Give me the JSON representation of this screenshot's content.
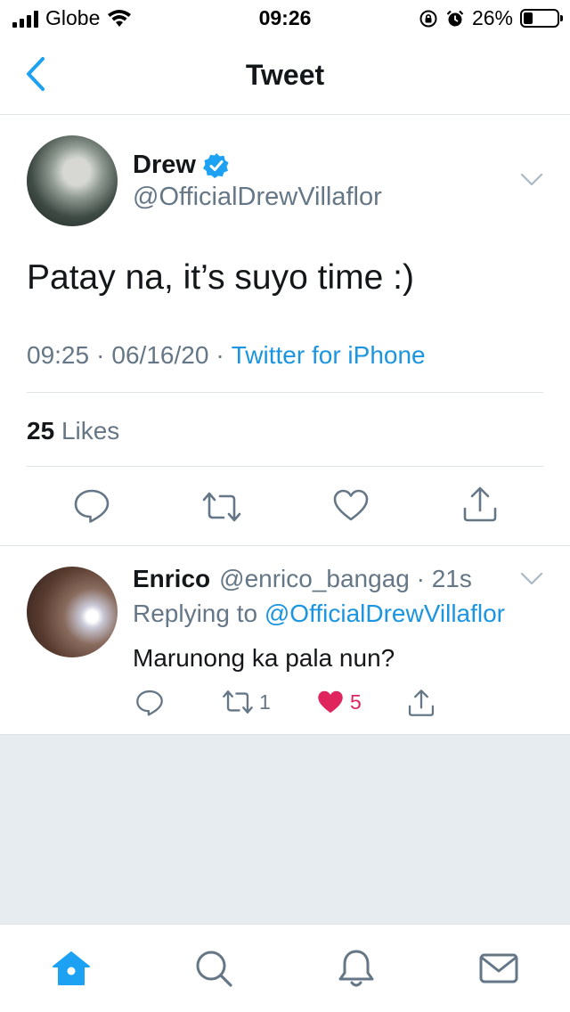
{
  "status_bar": {
    "carrier": "Globe",
    "time": "09:26",
    "battery_percent": "26%"
  },
  "header": {
    "title": "Tweet"
  },
  "tweet": {
    "display_name": "Drew",
    "handle": "@OfficialDrewVillaflor",
    "text": "Patay na, it’s suyo time :)",
    "time": "09:25",
    "dot1": "·",
    "date": "06/16/20",
    "dot2": "·",
    "source": "Twitter for iPhone",
    "like_count": "25",
    "likes_label": "Likes"
  },
  "reply": {
    "display_name": "Enrico",
    "handle_time": "@enrico_bangag · 21s",
    "replying_label": "Replying to",
    "replying_to": "@OfficialDrewVillaflor",
    "text": "Marunong ka pala nun?",
    "retweet_count": "1",
    "like_count": "5"
  },
  "colors": {
    "accent": "#1da1f2",
    "link": "#1b95e0",
    "like": "#e0245e",
    "secondary_text": "#657786",
    "divider": "#dfe3e6",
    "empty_background": "#e6ecf0"
  },
  "icons": {
    "status": [
      "signal-icon",
      "wifi-icon",
      "orientation-lock-icon",
      "alarm-icon",
      "battery-icon"
    ],
    "header": [
      "back-icon"
    ],
    "tweet_actions": [
      "reply-icon",
      "retweet-icon",
      "like-icon",
      "share-icon"
    ],
    "tabs": [
      "home-icon",
      "search-icon",
      "notifications-icon",
      "messages-icon"
    ]
  }
}
